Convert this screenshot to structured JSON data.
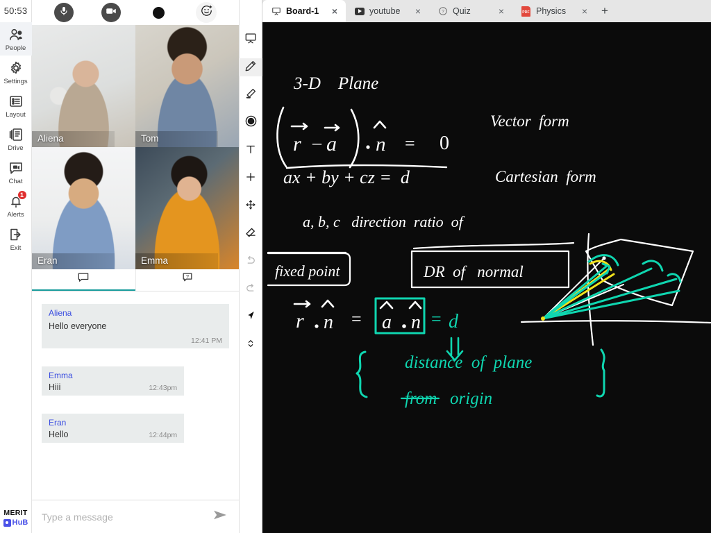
{
  "rail": {
    "timer": "50:53",
    "items": [
      {
        "label": "People",
        "icon": "people-icon",
        "active": true
      },
      {
        "label": "Settings",
        "icon": "gear-icon",
        "active": false
      },
      {
        "label": "Layout",
        "icon": "layout-icon",
        "active": false
      },
      {
        "label": "Drive",
        "icon": "drive-icon",
        "active": false
      },
      {
        "label": "Chat",
        "icon": "chat-video-icon",
        "active": false
      },
      {
        "label": "Alerts",
        "icon": "bell-icon",
        "active": false,
        "badge": "1"
      },
      {
        "label": "Exit",
        "icon": "exit-icon",
        "active": false
      }
    ],
    "brand": {
      "top": "MERIT",
      "bottom": "HuB"
    }
  },
  "av_bar": {
    "mic": "microphone-icon",
    "camera": "camera-icon",
    "record": "record-icon",
    "reaction": "emoji-add-icon"
  },
  "participants": [
    {
      "name": "Aliena"
    },
    {
      "name": "Tom"
    },
    {
      "name": "Eran"
    },
    {
      "name": "Emma"
    }
  ],
  "panel_tabs": [
    {
      "icon": "speech-bubble-icon",
      "name": "chat",
      "active": true
    },
    {
      "icon": "question-bubble-icon",
      "name": "questions",
      "active": false
    }
  ],
  "chat": {
    "messages": [
      {
        "who": "Aliena",
        "text": "Hello everyone",
        "time": "12:41 PM"
      },
      {
        "who": "Emma",
        "text": "Hiii",
        "time": "12:43pm"
      },
      {
        "who": "Eran",
        "text": "Hello",
        "time": "12:44pm"
      }
    ],
    "composer_placeholder": "Type a message",
    "composer_value": "",
    "send_icon": "send-icon"
  },
  "toolbar": {
    "tools": [
      {
        "name": "board-icon",
        "active": false,
        "disabled": false
      },
      {
        "name": "pencil-icon",
        "active": true,
        "disabled": false
      },
      {
        "name": "highlighter-icon",
        "active": false,
        "disabled": false
      },
      {
        "name": "circle-shape-icon",
        "active": false,
        "disabled": false
      },
      {
        "name": "text-tool-icon",
        "active": false,
        "disabled": false
      },
      {
        "name": "plus-icon",
        "active": false,
        "disabled": false
      },
      {
        "name": "move-icon",
        "active": false,
        "disabled": false
      },
      {
        "name": "eraser-icon",
        "active": false,
        "disabled": false
      },
      {
        "name": "undo-icon",
        "active": false,
        "disabled": true
      },
      {
        "name": "redo-icon",
        "active": false,
        "disabled": true
      },
      {
        "name": "cursor-icon",
        "active": false,
        "disabled": false
      },
      {
        "name": "updown-icon",
        "active": false,
        "disabled": false
      }
    ]
  },
  "browser": {
    "tabs": [
      {
        "title": "Board-1",
        "favicon": "board-icon",
        "active": true,
        "close": "×"
      },
      {
        "title": "youtube",
        "favicon": "youtube-icon",
        "active": false,
        "close": "×"
      },
      {
        "title": "Quiz",
        "favicon": "question-mark-icon",
        "active": false,
        "close": "×"
      },
      {
        "title": "Physics",
        "favicon": "pdf-icon",
        "active": false,
        "close": "×"
      }
    ],
    "new_tab_label": "+"
  },
  "whiteboard": {
    "background": "#0b0b0b",
    "ink_white": "#ffffff",
    "ink_teal": "#0fd6b0",
    "ink_yellow": "#f2e21c",
    "notes": [
      {
        "text": "3-D    Plane",
        "color": "#ffffff"
      },
      {
        "text": "( r⃗ − a⃗ ) . n̂  =  0",
        "color": "#ffffff"
      },
      {
        "text": "Vector  form",
        "color": "#ffffff"
      },
      {
        "text": "ax + by + cz = d",
        "color": "#ffffff"
      },
      {
        "text": "Cartesian  form",
        "color": "#ffffff"
      },
      {
        "text": "a, b, c   direction  ratio  of",
        "color": "#ffffff"
      },
      {
        "text": "fixed point",
        "color": "#ffffff"
      },
      {
        "text": "DR  of   normal",
        "color": "#ffffff"
      },
      {
        "text": "r⃗ . n̂  =  a⃗ . n̂  = d",
        "color": "#0fd6b0"
      },
      {
        "text": "distance  of  plane",
        "color": "#0fd6b0"
      },
      {
        "text": "from  origin",
        "color": "#0fd6b0"
      }
    ]
  }
}
